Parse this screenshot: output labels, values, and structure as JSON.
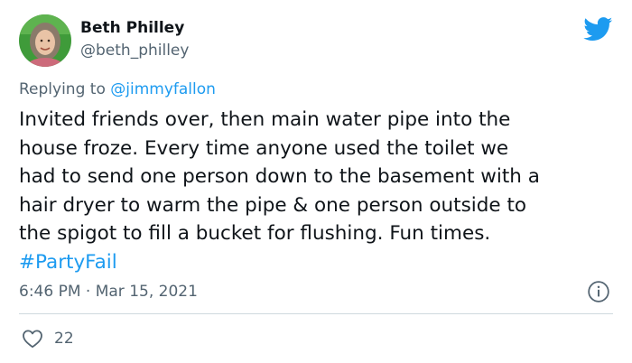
{
  "author": {
    "name": "Beth Philley",
    "handle": "@beth_philley"
  },
  "reply": {
    "prefix": "Replying to ",
    "handle": "@jimmyfallon"
  },
  "tweet": {
    "text_line1": "Invited friends over, then main water pipe into the",
    "text_line2": "house froze.  Every time anyone used the toilet we",
    "text_line3": "had to send one person down to the basement with a",
    "text_line4": "hair dryer to warm the pipe & one person outside to",
    "text_line5": "the spigot to fill a bucket for flushing.  Fun times.",
    "hashtag": "#PartyFail"
  },
  "meta": {
    "timestamp": "6:46 PM · Mar 15, 2021"
  },
  "stats": {
    "likes": "22"
  },
  "icons": {
    "brand": "twitter-bird-icon",
    "info": "info-icon",
    "like": "heart-icon"
  },
  "colors": {
    "accent": "#1d9bf0",
    "text": "#0f1419",
    "muted": "#536471",
    "divider": "#cfd9de"
  }
}
